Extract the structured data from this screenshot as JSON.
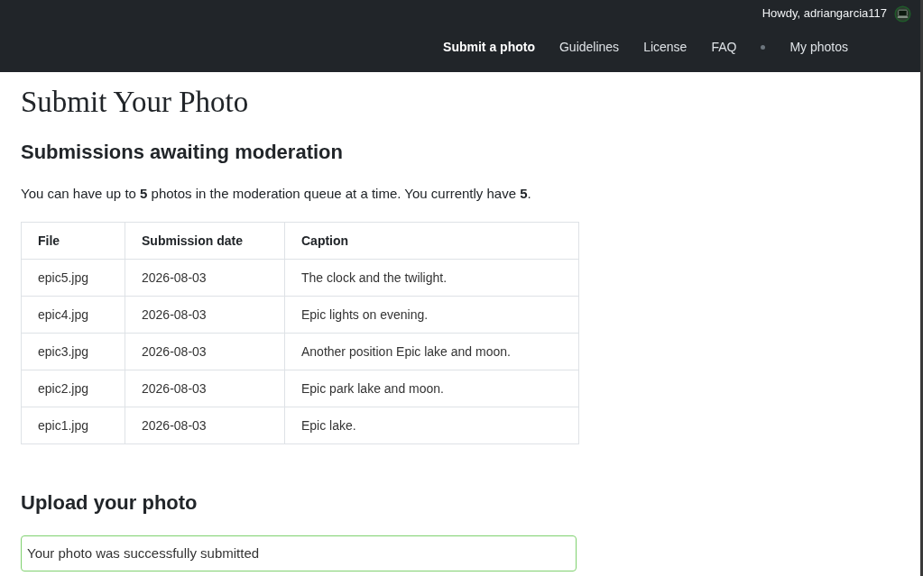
{
  "header": {
    "greeting": "Howdy, adriangarcia117",
    "nav": [
      {
        "label": "Submit a photo",
        "selected": true
      },
      {
        "label": "Guidelines",
        "selected": false
      },
      {
        "label": "License",
        "selected": false
      },
      {
        "label": "FAQ",
        "selected": false
      }
    ],
    "user_nav": [
      {
        "label": "My photos",
        "selected": false
      }
    ]
  },
  "title": "Submit Your Photo",
  "moderation": {
    "heading": "Submissions awaiting moderation",
    "text": "You can have up to **5** photos in the moderation queue at a time. You currently have **5**.",
    "table": {
      "columns": [
        "File",
        "Submission date",
        "Caption"
      ],
      "rows": [
        [
          "epic5.jpg",
          "2026-08-03",
          "The clock and the twilight."
        ],
        [
          "epic4.jpg",
          "2026-08-03",
          "Epic lights on evening."
        ],
        [
          "epic3.jpg",
          "2026-08-03",
          "Another position Epic lake and moon."
        ],
        [
          "epic2.jpg",
          "2026-08-03",
          "Epic park lake and moon."
        ],
        [
          "epic1.jpg",
          "2026-08-03",
          "Epic lake."
        ]
      ]
    }
  },
  "upload": {
    "heading": "Upload your photo",
    "alert": {
      "kind": "success",
      "text": "Your photo was successfully submitted"
    }
  }
}
